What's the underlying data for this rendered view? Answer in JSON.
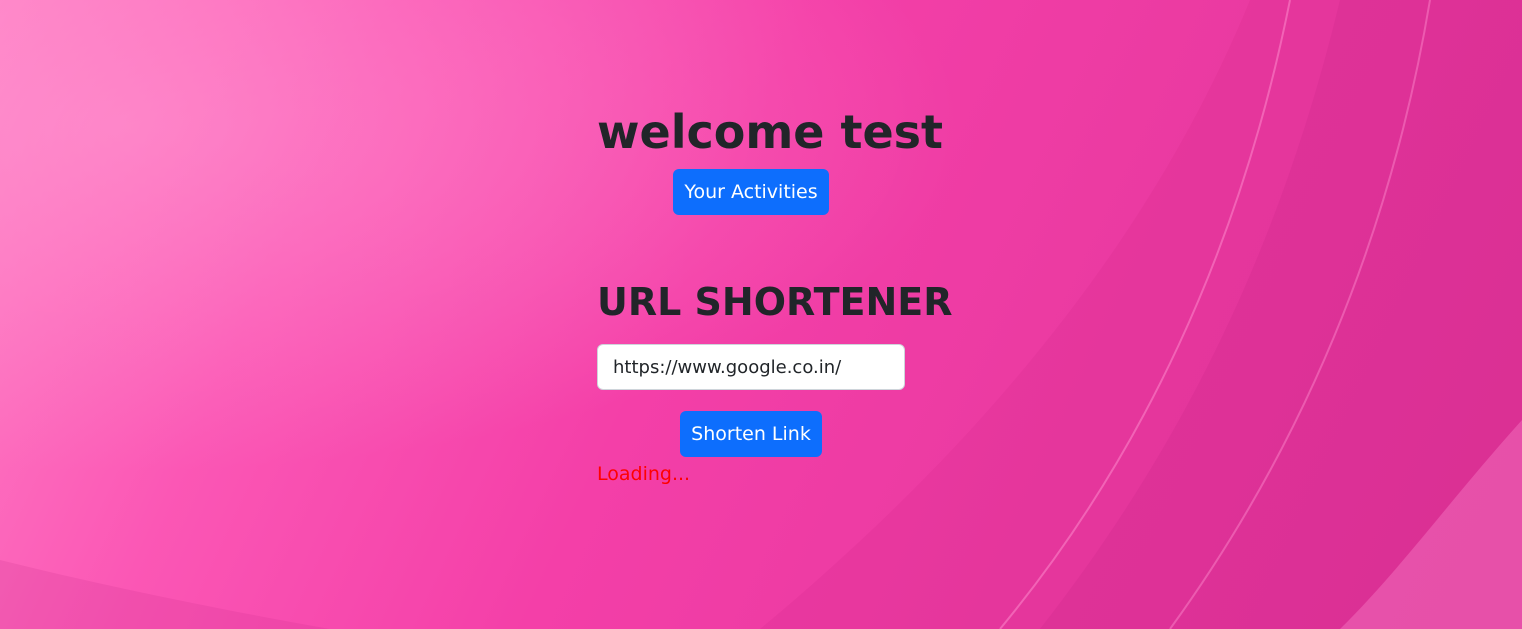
{
  "header": {
    "welcome_text": "welcome test",
    "activities_button_label": "Your Activities"
  },
  "shortener": {
    "title": "URL SHORTENER",
    "url_input_value": "https://www.google.co.in/",
    "shorten_button_label": "Shorten Link",
    "status_text": "Loading..."
  },
  "colors": {
    "primary_button": "#0d6efd",
    "status_text": "#ff0000",
    "heading_text": "#212529",
    "background_main": "#f43fa8"
  }
}
